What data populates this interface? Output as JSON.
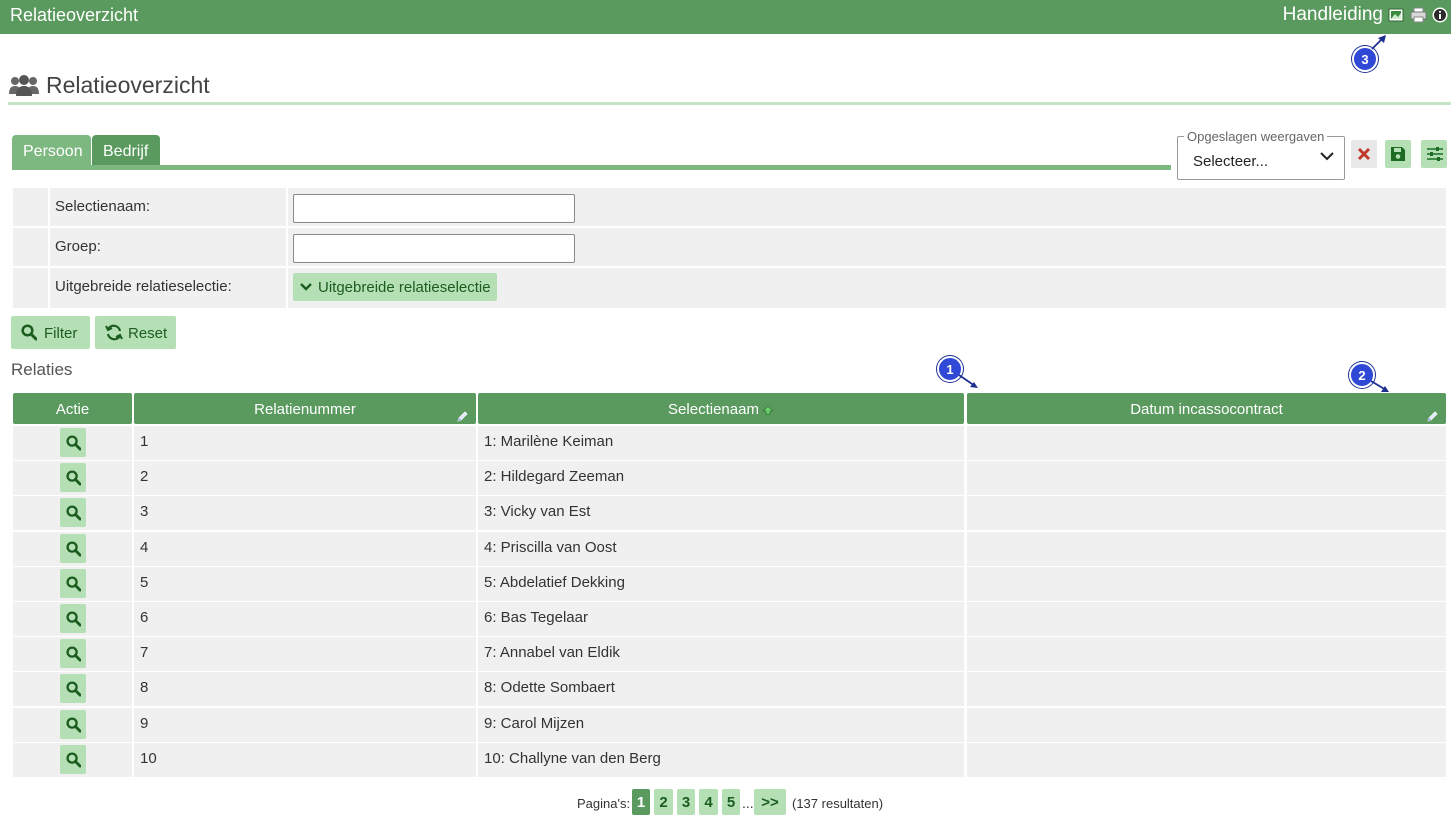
{
  "app": {
    "title": "Relatieoverzicht"
  },
  "topbar": {
    "manual_label": "Handleiding",
    "icons": [
      "image-icon",
      "printer-icon",
      "info-icon"
    ]
  },
  "page": {
    "title": "Relatieoverzicht",
    "icon": "users-icon"
  },
  "tabs": [
    {
      "label": "Persoon",
      "active": true
    },
    {
      "label": "Bedrijf",
      "active": false
    }
  ],
  "saved_views": {
    "legend": "Opgeslagen weergaven",
    "selected": "Selecteer..."
  },
  "toolbar_icons": [
    "delete-icon",
    "save-icon",
    "sliders-icon"
  ],
  "filters": {
    "selectienaam_label": "Selectienaam:",
    "selectienaam_value": "",
    "groep_label": "Groep:",
    "groep_value": "",
    "advanced_label": "Uitgebreide relatieselectie:",
    "advanced_button": "Uitgebreide relatieselectie"
  },
  "buttons": {
    "filter": "Filter",
    "reset": "Reset"
  },
  "section": {
    "label": "Relaties"
  },
  "table": {
    "columns": [
      "Actie",
      "Relatienummer",
      "Selectienaam",
      "Datum incassocontract"
    ],
    "rows": [
      {
        "nummer": "1",
        "naam": "1: Marilène Keiman",
        "datum": ""
      },
      {
        "nummer": "2",
        "naam": "2: Hildegard Zeeman",
        "datum": ""
      },
      {
        "nummer": "3",
        "naam": "3: Vicky van Est",
        "datum": ""
      },
      {
        "nummer": "4",
        "naam": "4: Priscilla van Oost",
        "datum": ""
      },
      {
        "nummer": "5",
        "naam": "5: Abdelatief Dekking",
        "datum": ""
      },
      {
        "nummer": "6",
        "naam": "6: Bas Tegelaar",
        "datum": ""
      },
      {
        "nummer": "7",
        "naam": "7: Annabel van Eldik",
        "datum": ""
      },
      {
        "nummer": "8",
        "naam": "8: Odette Sombaert",
        "datum": ""
      },
      {
        "nummer": "9",
        "naam": "9: Carol Mijzen",
        "datum": ""
      },
      {
        "nummer": "10",
        "naam": "10: Challyne van den Berg",
        "datum": ""
      }
    ]
  },
  "pagination": {
    "label": "Pagina's:",
    "pages": [
      "1",
      "2",
      "3",
      "4",
      "5"
    ],
    "current": "1",
    "ellipsis": "...",
    "next": ">>",
    "results": "(137 resultaten)"
  },
  "annotations": [
    "1",
    "2",
    "3"
  ],
  "colors": {
    "brand_green": "#5a9a5e",
    "tab_green": "#7eb881",
    "button_light_green": "#b5e0b6",
    "badge_blue": "#2f49d6",
    "delete_red": "#c0392b"
  }
}
